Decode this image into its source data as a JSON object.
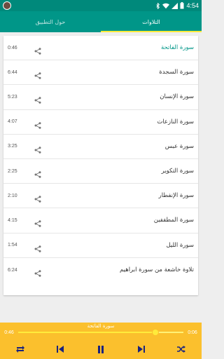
{
  "status_bar": {
    "time": "4:54"
  },
  "tabs": [
    {
      "label": "التلاوات",
      "active": true
    },
    {
      "label": "حول التطبيق",
      "active": false
    }
  ],
  "tracks": [
    {
      "title": "سورة الفاتحة",
      "duration": "0:46",
      "playing": true
    },
    {
      "title": "سورة السجدة",
      "duration": "6:44"
    },
    {
      "title": "سورة الإنسان",
      "duration": "5:23"
    },
    {
      "title": "سورة النازعات",
      "duration": "4:07"
    },
    {
      "title": "سورة عبس",
      "duration": "3:25"
    },
    {
      "title": "سورة التكوير",
      "duration": "2:25"
    },
    {
      "title": "سورة الإنفطار",
      "duration": "2:10"
    },
    {
      "title": "سورة المطففين",
      "duration": "4:15"
    },
    {
      "title": "سورة الليل",
      "duration": "1:54"
    },
    {
      "title": "تلاوة خاشعة من سورة ابراهيم",
      "duration": "6:24"
    }
  ],
  "player": {
    "now_playing": "سورة الفاتحة",
    "elapsed": "0:46",
    "total": "0:06",
    "progress": 0.83,
    "icons": [
      "repeat-icon",
      "previous-icon",
      "pause-icon",
      "next-icon",
      "shuffle-icon"
    ]
  },
  "colors": {
    "primary": "#009688",
    "accent": "#ffeb3b",
    "player": "#fbc02d"
  }
}
